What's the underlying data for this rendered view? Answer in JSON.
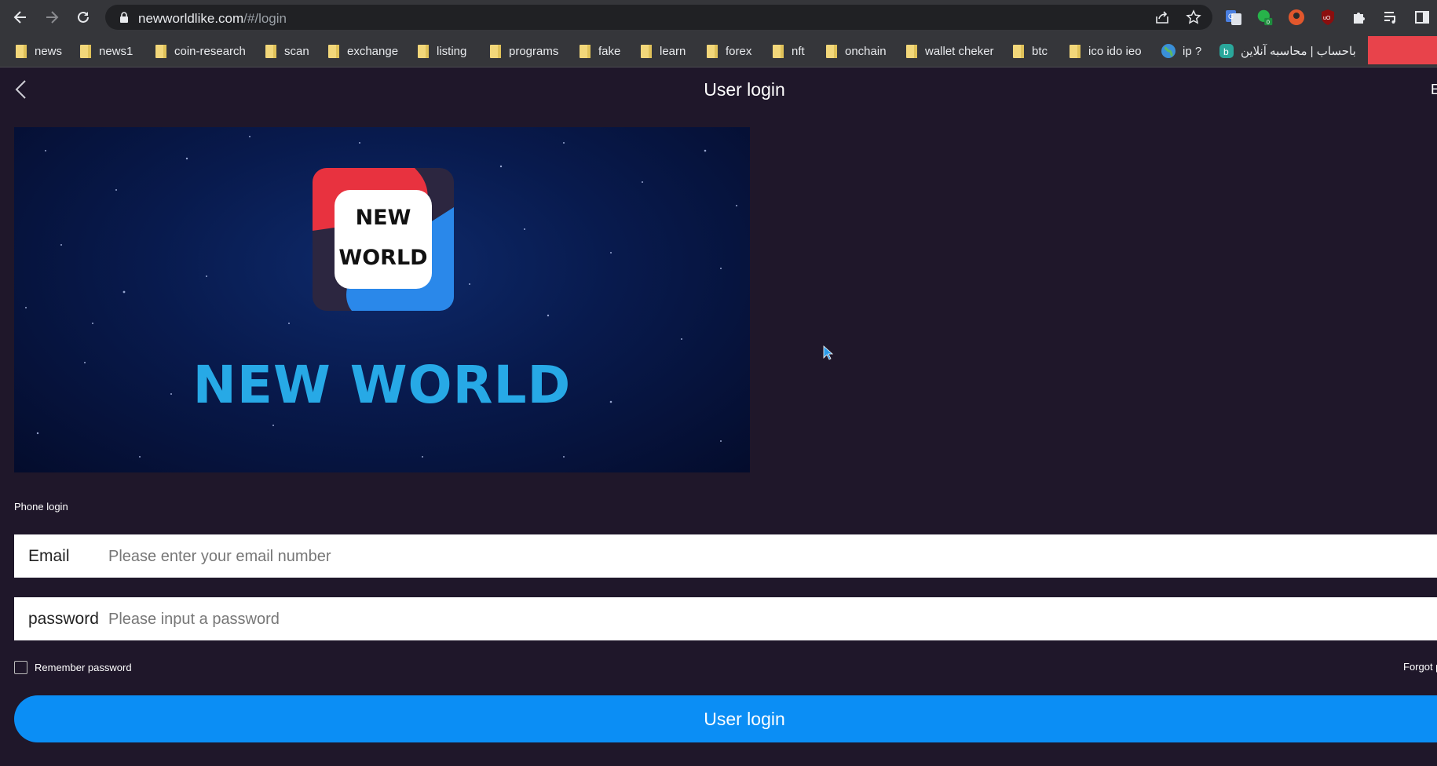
{
  "browser": {
    "url_host": "newworldlike.com",
    "url_path": "/#/login",
    "bookmarks": [
      "news",
      "news1",
      "coin-research",
      "scan",
      "exchange",
      "listing",
      "programs",
      "fake",
      "learn",
      "forex",
      "nft",
      "onchain",
      "wallet cheker",
      "btc",
      "ico ido ieo",
      "ip ?",
      "باحساب | محاسبه آنلاین"
    ],
    "extension_badge": "0"
  },
  "header": {
    "title": "User login",
    "lang_partial": "E"
  },
  "banner": {
    "logo_line1": "NEW",
    "logo_line2": "WORLD",
    "brand_text": "NEW WORLD"
  },
  "login": {
    "tab_label": "Phone login",
    "email_label": "Email",
    "email_placeholder": "Please enter your email number",
    "password_label": "password",
    "password_placeholder": "Please input a password",
    "remember_label": "Remember password",
    "forgot_label": "Forgot p",
    "submit_label": "User login"
  },
  "colors": {
    "page_bg": "#1f172a",
    "accent": "#0b8ef5",
    "brand_text": "#27a9e6"
  }
}
